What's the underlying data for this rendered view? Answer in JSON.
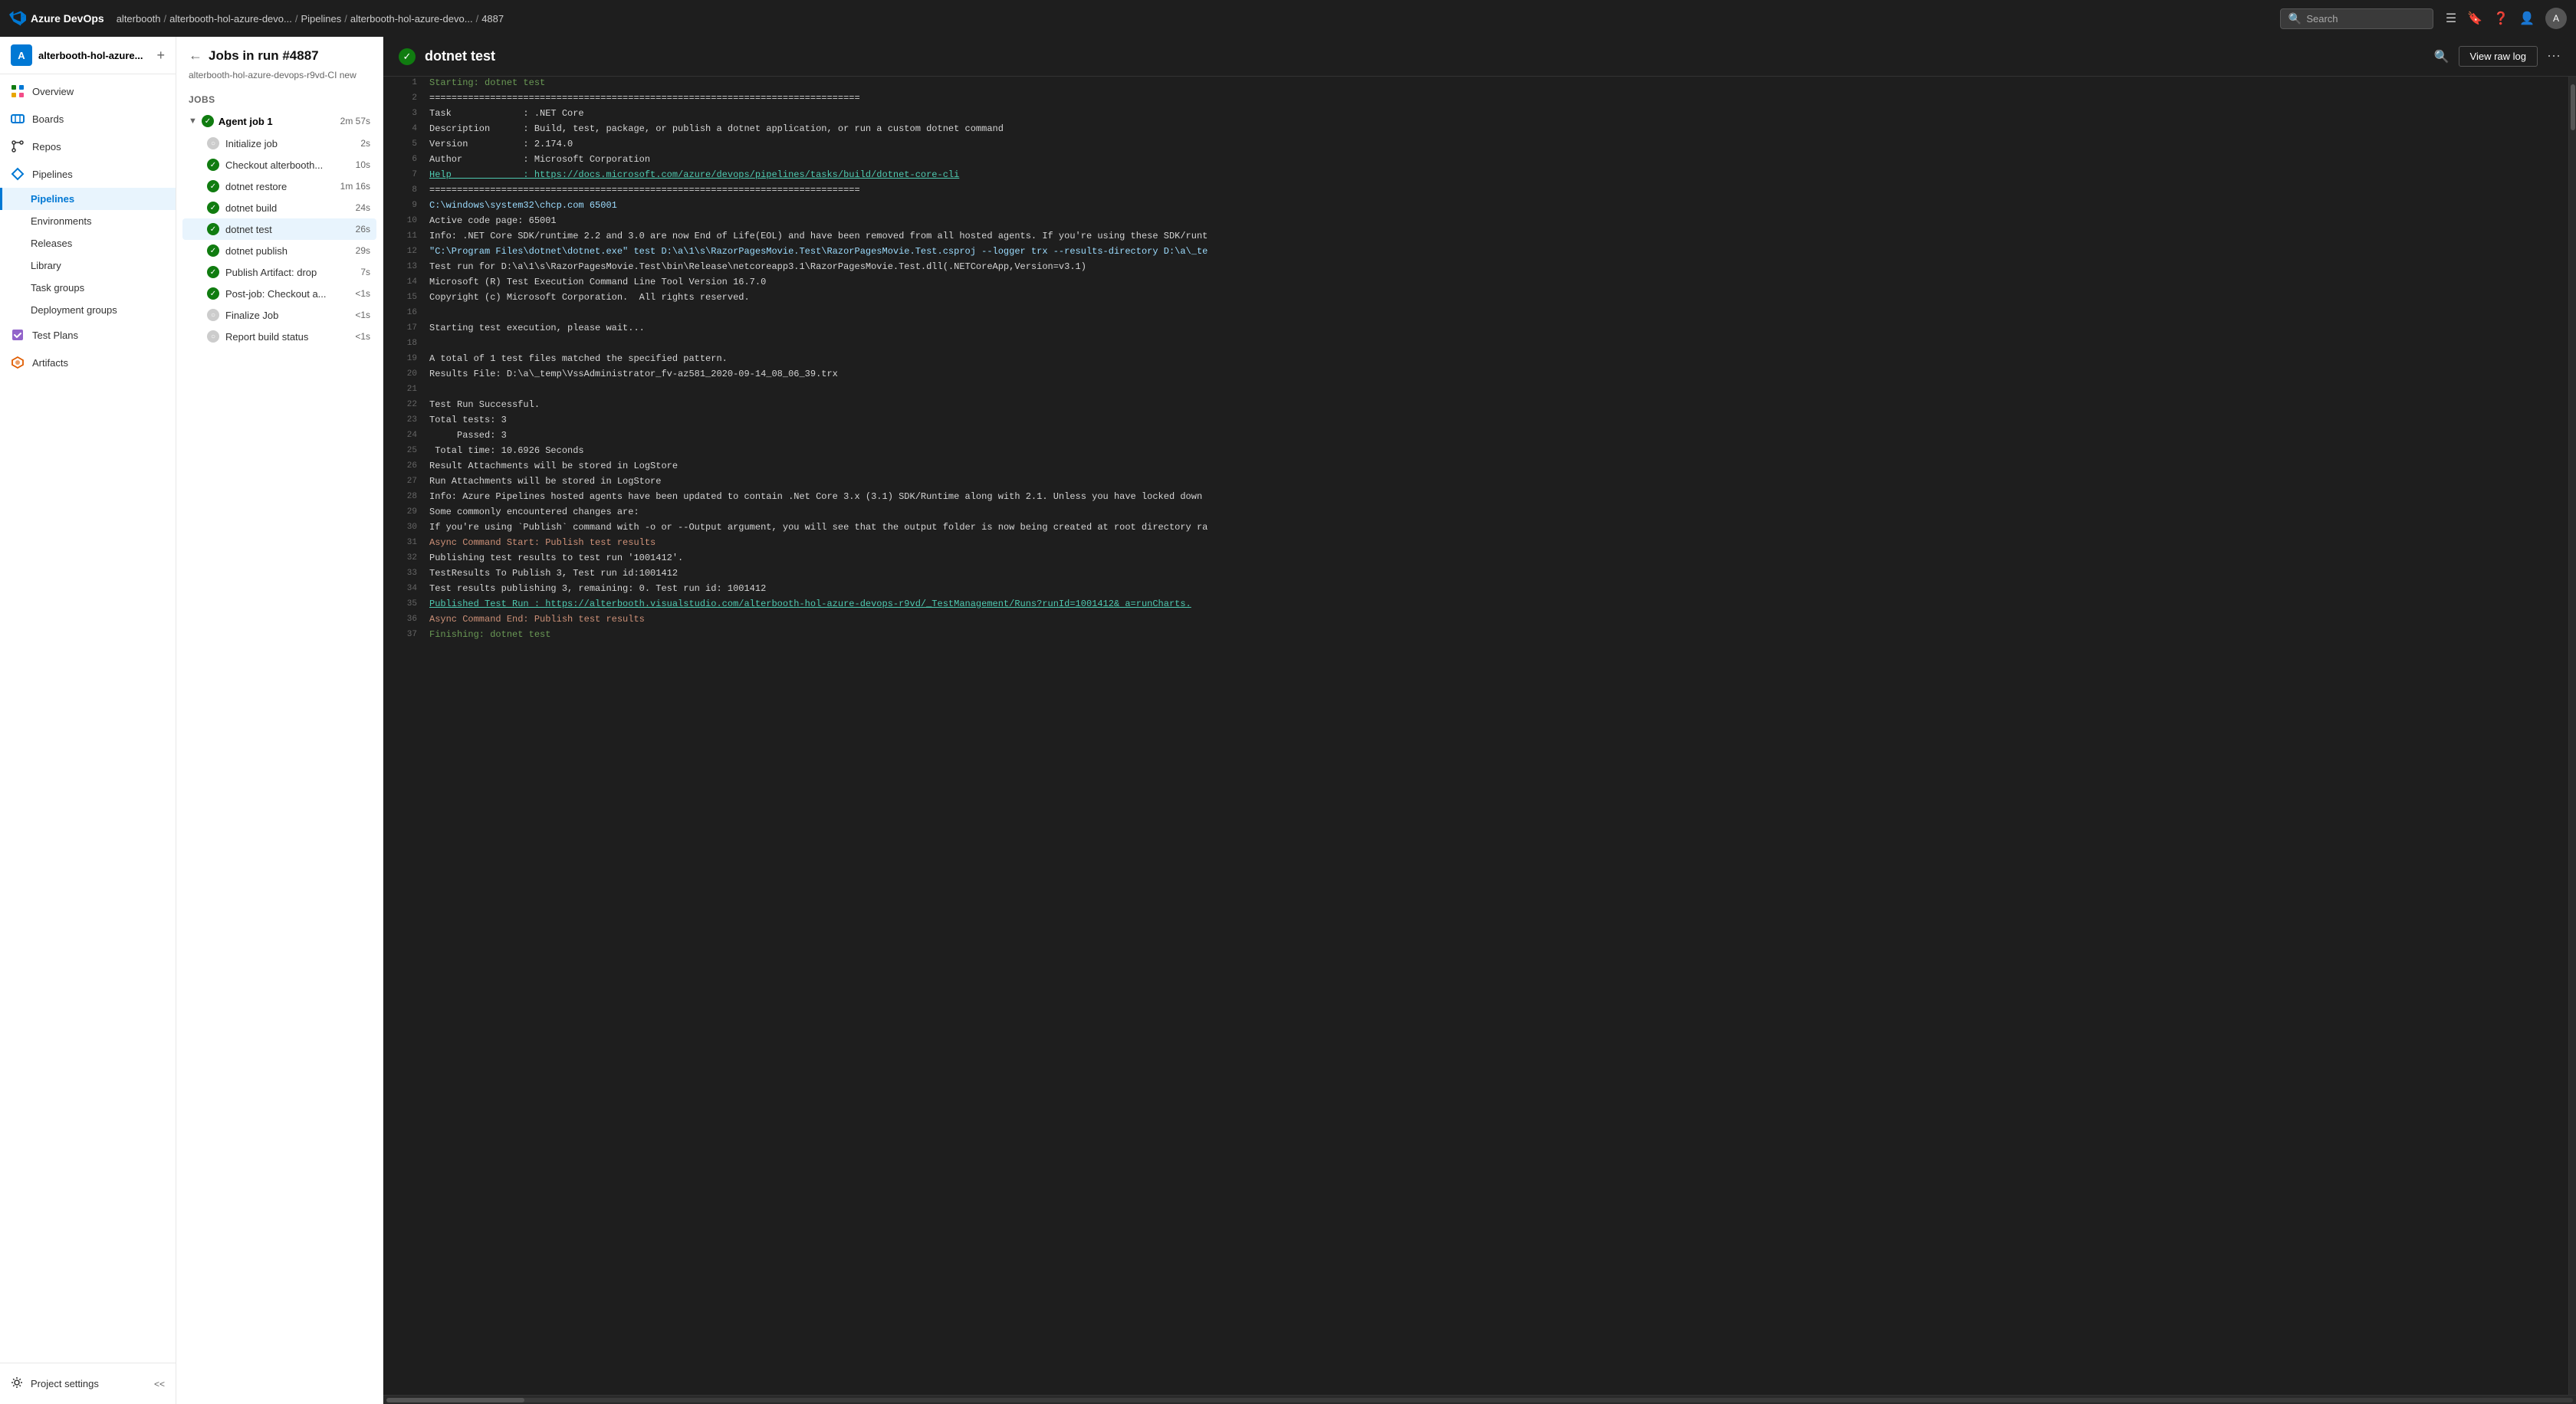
{
  "topnav": {
    "logo_text": "Azure DevOps",
    "breadcrumb": [
      {
        "label": "alterbooth",
        "link": true
      },
      {
        "label": "alterbooth-hol-azure-devo...",
        "link": true
      },
      {
        "label": "Pipelines",
        "link": true
      },
      {
        "label": "alterbooth-hol-azure-devo...",
        "link": true
      },
      {
        "label": "4887",
        "link": true
      }
    ],
    "search_placeholder": "Search",
    "icons": [
      "list-icon",
      "bookmark-icon",
      "help-icon",
      "user-icon",
      "avatar-icon"
    ]
  },
  "sidebar": {
    "org_name": "alterbooth-hol-azure...",
    "items": [
      {
        "label": "Overview",
        "icon": "overview-icon",
        "active": false
      },
      {
        "label": "Boards",
        "icon": "boards-icon",
        "active": false
      },
      {
        "label": "Repos",
        "icon": "repos-icon",
        "active": false
      },
      {
        "label": "Pipelines",
        "icon": "pipelines-icon",
        "active": true
      },
      {
        "label": "Pipelines",
        "icon": "pipelines-sub-icon",
        "active": true,
        "sub": true
      },
      {
        "label": "Environments",
        "icon": "environments-icon",
        "active": false,
        "sub": true
      },
      {
        "label": "Releases",
        "icon": "releases-icon",
        "active": false,
        "sub": true
      },
      {
        "label": "Library",
        "icon": "library-icon",
        "active": false,
        "sub": true
      },
      {
        "label": "Task groups",
        "icon": "task-groups-icon",
        "active": false,
        "sub": true
      },
      {
        "label": "Deployment groups",
        "icon": "deployment-groups-icon",
        "active": false,
        "sub": true
      },
      {
        "label": "Test Plans",
        "icon": "test-plans-icon",
        "active": false
      },
      {
        "label": "Artifacts",
        "icon": "artifacts-icon",
        "active": false
      }
    ],
    "footer": {
      "settings_label": "Project settings",
      "collapse_label": "<<"
    }
  },
  "middle": {
    "back_btn": "←",
    "title": "Jobs in run #4887",
    "subtitle": "alterbooth-hol-azure-devops-r9vd-CI new",
    "jobs_label": "Jobs",
    "job_group": {
      "name": "Agent job 1",
      "duration": "2m 57s",
      "status": "success"
    },
    "job_items": [
      {
        "name": "Initialize job",
        "duration": "2s",
        "status": "pending"
      },
      {
        "name": "Checkout alterbooth...",
        "duration": "10s",
        "status": "success"
      },
      {
        "name": "dotnet restore",
        "duration": "1m 16s",
        "status": "success"
      },
      {
        "name": "dotnet build",
        "duration": "24s",
        "status": "success"
      },
      {
        "name": "dotnet test",
        "duration": "26s",
        "status": "success",
        "active": true
      },
      {
        "name": "dotnet publish",
        "duration": "29s",
        "status": "success"
      },
      {
        "name": "Publish Artifact: drop",
        "duration": "7s",
        "status": "success"
      },
      {
        "name": "Post-job: Checkout a...",
        "duration": "<1s",
        "status": "success"
      },
      {
        "name": "Finalize Job",
        "duration": "<1s",
        "status": "pending"
      },
      {
        "name": "Report build status",
        "duration": "<1s",
        "status": "pending"
      }
    ]
  },
  "log": {
    "title": "dotnet test",
    "view_raw_label": "View raw log",
    "lines": [
      {
        "num": 1,
        "text": "Starting: dotnet test",
        "class": "green"
      },
      {
        "num": 2,
        "text": "==============================================================================",
        "class": ""
      },
      {
        "num": 3,
        "text": "Task             : .NET Core",
        "class": ""
      },
      {
        "num": 4,
        "text": "Description      : Build, test, package, or publish a dotnet application, or run a custom dotnet command",
        "class": ""
      },
      {
        "num": 5,
        "text": "Version          : 2.174.0",
        "class": ""
      },
      {
        "num": 6,
        "text": "Author           : Microsoft Corporation",
        "class": ""
      },
      {
        "num": 7,
        "text": "Help             : https://docs.microsoft.com/azure/devops/pipelines/tasks/build/dotnet-core-cli",
        "class": "link"
      },
      {
        "num": 8,
        "text": "==============================================================================",
        "class": ""
      },
      {
        "num": 9,
        "text": "C:\\windows\\system32\\chcp.com 65001",
        "class": "cmd"
      },
      {
        "num": 10,
        "text": "Active code page: 65001",
        "class": ""
      },
      {
        "num": 11,
        "text": "Info: .NET Core SDK/runtime 2.2 and 3.0 are now End of Life(EOL) and have been removed from all hosted agents. If you're using these SDK/runt",
        "class": ""
      },
      {
        "num": 12,
        "text": "\"C:\\Program Files\\dotnet\\dotnet.exe\" test D:\\a\\1\\s\\RazorPagesMovie.Test\\RazorPagesMovie.Test.csproj --logger trx --results-directory D:\\a\\_te",
        "class": "cmd"
      },
      {
        "num": 13,
        "text": "Test run for D:\\a\\1\\s\\RazorPagesMovie.Test\\bin\\Release\\netcoreapp3.1\\RazorPagesMovie.Test.dll(.NETCoreApp,Version=v3.1)",
        "class": ""
      },
      {
        "num": 14,
        "text": "Microsoft (R) Test Execution Command Line Tool Version 16.7.0",
        "class": ""
      },
      {
        "num": 15,
        "text": "Copyright (c) Microsoft Corporation.  All rights reserved.",
        "class": ""
      },
      {
        "num": 16,
        "text": "",
        "class": ""
      },
      {
        "num": 17,
        "text": "Starting test execution, please wait...",
        "class": ""
      },
      {
        "num": 18,
        "text": "",
        "class": ""
      },
      {
        "num": 19,
        "text": "A total of 1 test files matched the specified pattern.",
        "class": ""
      },
      {
        "num": 20,
        "text": "Results File: D:\\a\\_temp\\VssAdministrator_fv-az581_2020-09-14_08_06_39.trx",
        "class": ""
      },
      {
        "num": 21,
        "text": "",
        "class": ""
      },
      {
        "num": 22,
        "text": "Test Run Successful.",
        "class": ""
      },
      {
        "num": 23,
        "text": "Total tests: 3",
        "class": ""
      },
      {
        "num": 24,
        "text": "     Passed: 3",
        "class": ""
      },
      {
        "num": 25,
        "text": " Total time: 10.6926 Seconds",
        "class": ""
      },
      {
        "num": 26,
        "text": "Result Attachments will be stored in LogStore",
        "class": ""
      },
      {
        "num": 27,
        "text": "Run Attachments will be stored in LogStore",
        "class": ""
      },
      {
        "num": 28,
        "text": "Info: Azure Pipelines hosted agents have been updated to contain .Net Core 3.x (3.1) SDK/Runtime along with 2.1. Unless you have locked down",
        "class": ""
      },
      {
        "num": 29,
        "text": "Some commonly encountered changes are:",
        "class": ""
      },
      {
        "num": 30,
        "text": "If you're using `Publish` command with -o or --Output argument, you will see that the output folder is now being created at root directory ra",
        "class": ""
      },
      {
        "num": 31,
        "text": "Async Command Start: Publish test results",
        "class": "orange"
      },
      {
        "num": 32,
        "text": "Publishing test results to test run '1001412'.",
        "class": ""
      },
      {
        "num": 33,
        "text": "TestResults To Publish 3, Test run id:1001412",
        "class": ""
      },
      {
        "num": 34,
        "text": "Test results publishing 3, remaining: 0. Test run id: 1001412",
        "class": ""
      },
      {
        "num": 35,
        "text": "Published Test Run : https://alterbooth.visualstudio.com/alterbooth-hol-azure-devops-r9vd/_TestManagement/Runs?runId=1001412& a=runCharts.",
        "class": "link"
      },
      {
        "num": 36,
        "text": "Async Command End: Publish test results",
        "class": "orange"
      },
      {
        "num": 37,
        "text": "Finishing: dotnet test",
        "class": "green"
      }
    ]
  }
}
